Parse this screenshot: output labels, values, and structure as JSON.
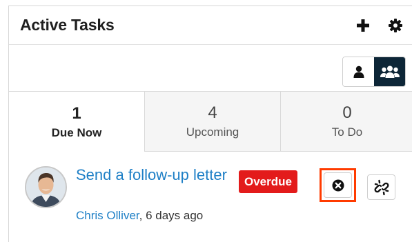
{
  "dashlet": {
    "title": "Active Tasks",
    "header_icons": [
      "plus-icon",
      "gear-icon"
    ]
  },
  "toolbar": {
    "toggle": [
      {
        "icon": "user-icon",
        "active": false
      },
      {
        "icon": "group-icon",
        "active": true
      }
    ]
  },
  "tabs": [
    {
      "count": "1",
      "label": "Due Now",
      "active": true
    },
    {
      "count": "4",
      "label": "Upcoming",
      "active": false
    },
    {
      "count": "0",
      "label": "To Do",
      "active": false
    }
  ],
  "task": {
    "title": "Send a follow-up letter",
    "status": "Overdue",
    "assignee": "Chris Olliver",
    "time": ", 6 days ago",
    "actions": [
      "close-circle-icon",
      "unlink-icon"
    ]
  },
  "colors": {
    "link": "#1e7fc6",
    "overdue": "#e31b1b",
    "toggle_active": "#0d2637",
    "highlight": "#ff3b00"
  }
}
